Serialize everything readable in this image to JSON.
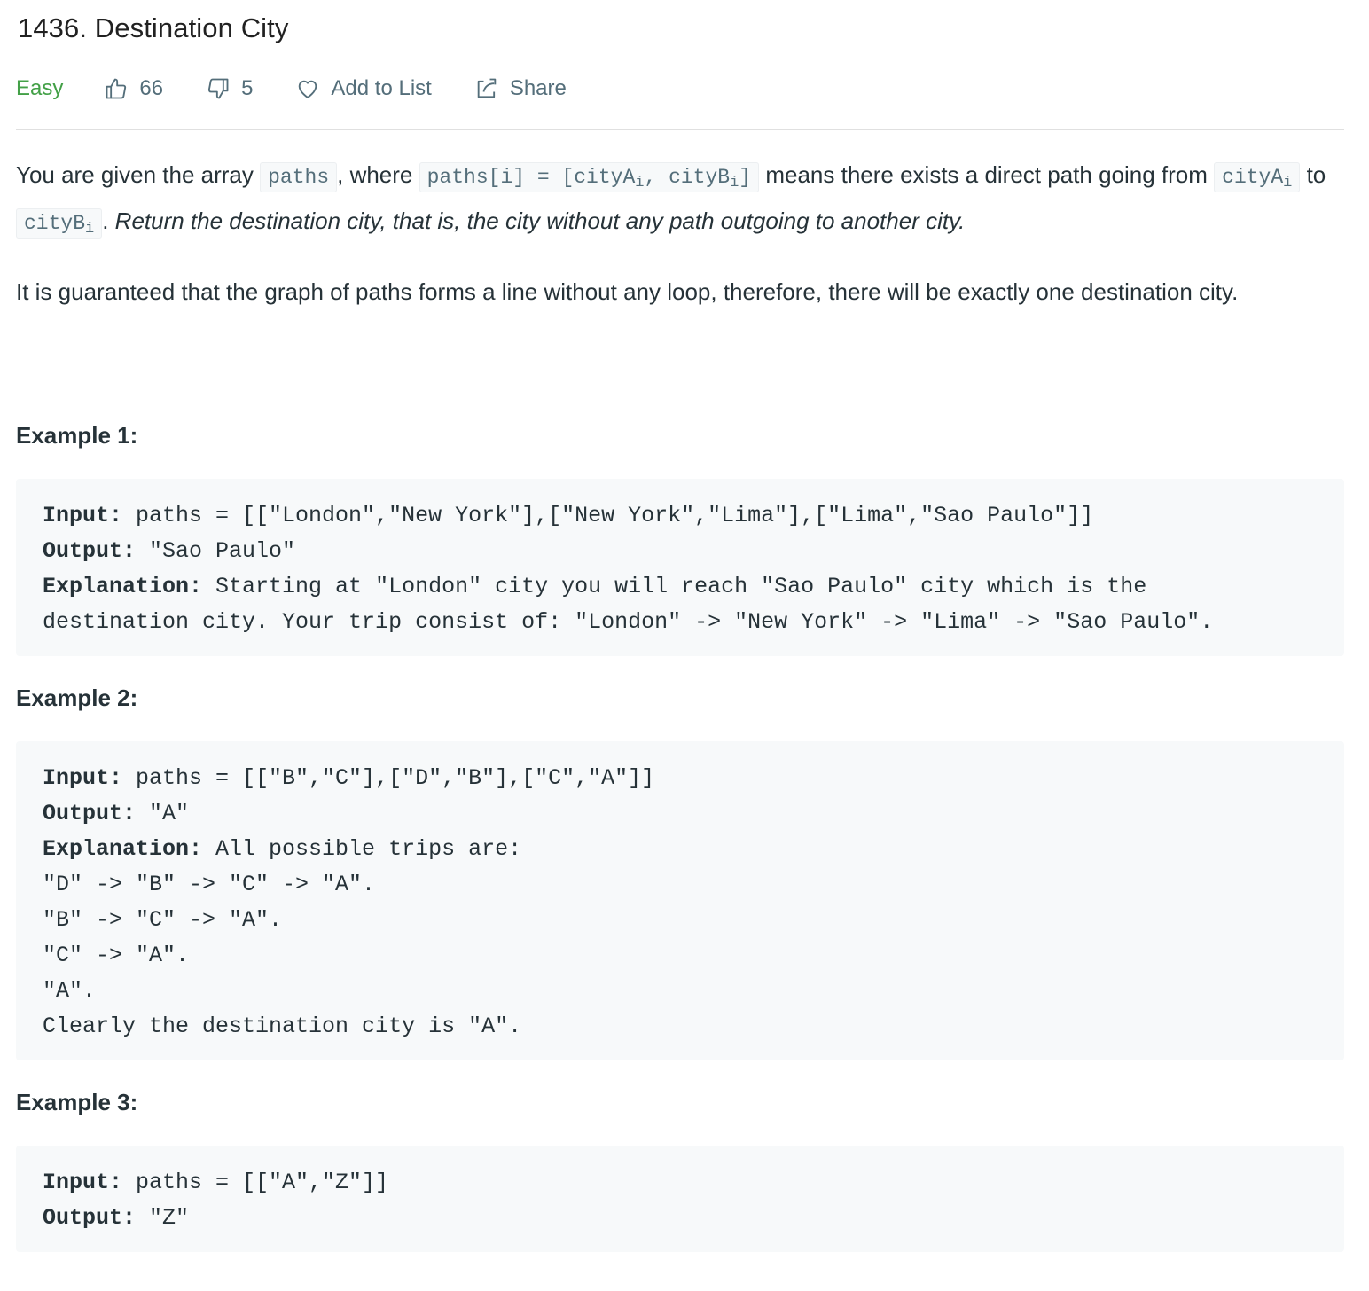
{
  "problem": {
    "title": "1436. Destination City",
    "difficulty": "Easy",
    "likes": "66",
    "dislikes": "5",
    "add_to_list": "Add to List",
    "share": "Share"
  },
  "description": {
    "p1_a": "You are given the array ",
    "code_paths": "paths",
    "p1_b": ", where ",
    "code_pathsi_pre": "paths[i] = [cityA",
    "code_pathsi_mid": ", cityB",
    "code_pathsi_end": "]",
    "sub_i": "i",
    "p1_c": " means there exists a direct path going from ",
    "code_cityA": "cityA",
    "p1_d": " to ",
    "code_cityB": "cityB",
    "p1_e": ". ",
    "p1_italic": "Return the destination city, that is, the city without any path outgoing to another city.",
    "p2": "It is guaranteed that the graph of paths forms a line without any loop, therefore, there will be exactly one destination city."
  },
  "examples": [
    {
      "title": "Example 1:",
      "input_label": "Input:",
      "input": " paths = [[\"London\",\"New York\"],[\"New York\",\"Lima\"],[\"Lima\",\"Sao Paulo\"]]",
      "output_label": "Output:",
      "output": " \"Sao Paulo\"",
      "explanation_label": "Explanation:",
      "explanation": " Starting at \"London\" city you will reach \"Sao Paulo\" city which is the \ndestination city. Your trip consist of: \"London\" -> \"New York\" -> \"Lima\" -> \"Sao Paulo\"."
    },
    {
      "title": "Example 2:",
      "input_label": "Input:",
      "input": " paths = [[\"B\",\"C\"],[\"D\",\"B\"],[\"C\",\"A\"]]",
      "output_label": "Output:",
      "output": " \"A\"",
      "explanation_label": "Explanation:",
      "explanation": " All possible trips are: \n\"D\" -> \"B\" -> \"C\" -> \"A\". \n\"B\" -> \"C\" -> \"A\". \n\"C\" -> \"A\". \n\"A\". \nClearly the destination city is \"A\"."
    },
    {
      "title": "Example 3:",
      "input_label": "Input:",
      "input": " paths = [[\"A\",\"Z\"]]",
      "output_label": "Output:",
      "output": " \"Z\""
    }
  ],
  "colors": {
    "easy": "#43a047",
    "text": "#263238",
    "muted": "#546e7a",
    "code_bg": "#f7f9fa"
  }
}
